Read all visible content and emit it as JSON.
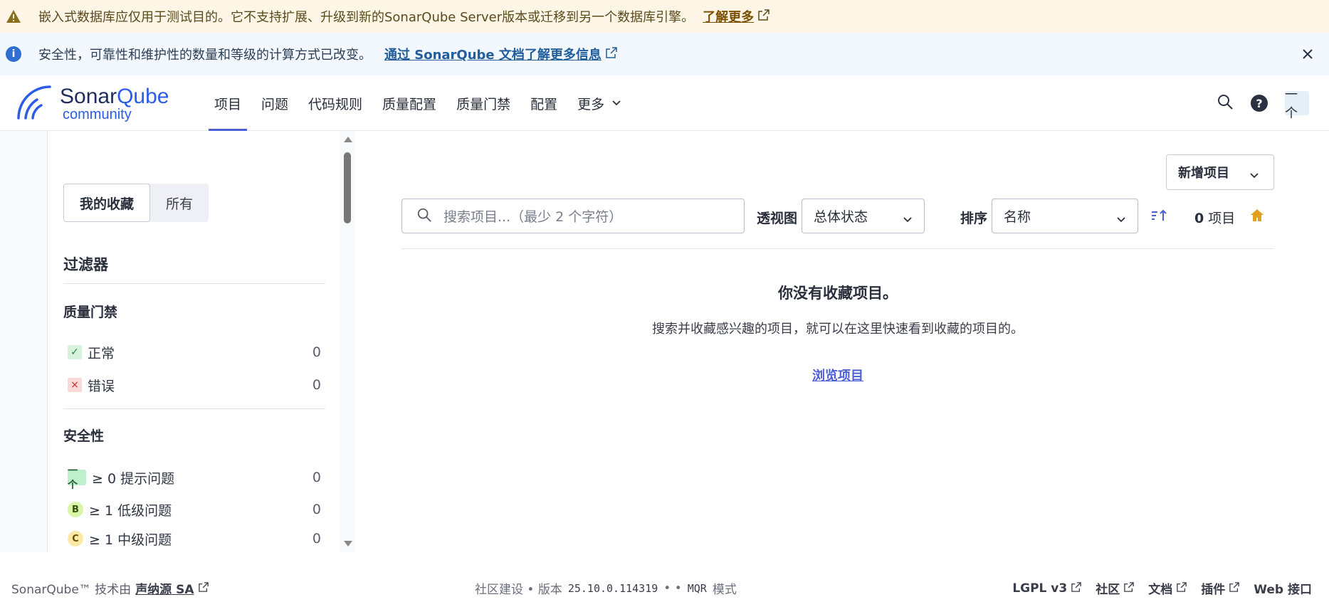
{
  "warning_banner": {
    "text": "嵌入式数据库应仅用于测试目的。它不支持扩展、升级到新的SonarQube Server版本或迁移到另一个数据库引擎。",
    "link": "了解更多"
  },
  "info_banner": {
    "text": "安全性，可靠性和维护性的数量和等级的计算方式已改变。",
    "link": "通过 SonarQube 文档了解更多信息"
  },
  "logo": {
    "name_part1": "Sonar",
    "name_part2": "Qube",
    "edition": "community"
  },
  "nav": {
    "items": [
      {
        "label": "项目"
      },
      {
        "label": "问题"
      },
      {
        "label": "代码规则"
      },
      {
        "label": "质量配置"
      },
      {
        "label": "质量门禁"
      },
      {
        "label": "配置"
      },
      {
        "label": "更多"
      }
    ],
    "avatar_text": "一个"
  },
  "sidebar": {
    "toggle": {
      "favorites": "我的收藏",
      "all": "所有"
    },
    "filters_title": "过滤器",
    "quality_gate": {
      "title": "质量门禁",
      "items": [
        {
          "label": "正常",
          "count": "0"
        },
        {
          "label": "错误",
          "count": "0"
        }
      ]
    },
    "security": {
      "title": "安全性",
      "items": [
        {
          "badge": "一个",
          "label": "≥ 0 提示问题",
          "count": "0"
        },
        {
          "badge": "B",
          "label": "≥ 1 低级问题",
          "count": "0"
        },
        {
          "badge": "C",
          "label": "≥ 1 中级问题",
          "count": "0"
        }
      ]
    }
  },
  "main": {
    "new_project": "新增项目",
    "search_placeholder": "搜索项目...（最少 2 个字符）",
    "perspective_label": "透视图",
    "perspective_value": "总体状态",
    "sort_label": "排序",
    "sort_value": "名称",
    "count_number": "0",
    "count_unit": "项目",
    "empty_title": "你没有收藏项目。",
    "empty_text": "搜索并收藏感兴趣的项目，就可以在这里快速看到收藏的项目的。",
    "browse_link": "浏览项目"
  },
  "footer": {
    "left_prefix": "SonarQube™ 技术由",
    "company": "声纳源 SA",
    "center_prefix": "社区建设 • 版本",
    "version": "25.10.0.114319",
    "center_sep": "• •",
    "mode_code": "MQR",
    "mode_suffix": "模式",
    "links": [
      "LGPL v3",
      "社区",
      "文档",
      "插件",
      "Web 接口"
    ]
  },
  "colors": {
    "accent": "#4d5fd5",
    "warning_bg": "#fdf6e6",
    "info_bg": "#f2f8fe",
    "brand_blue": "#2a5ce8"
  }
}
